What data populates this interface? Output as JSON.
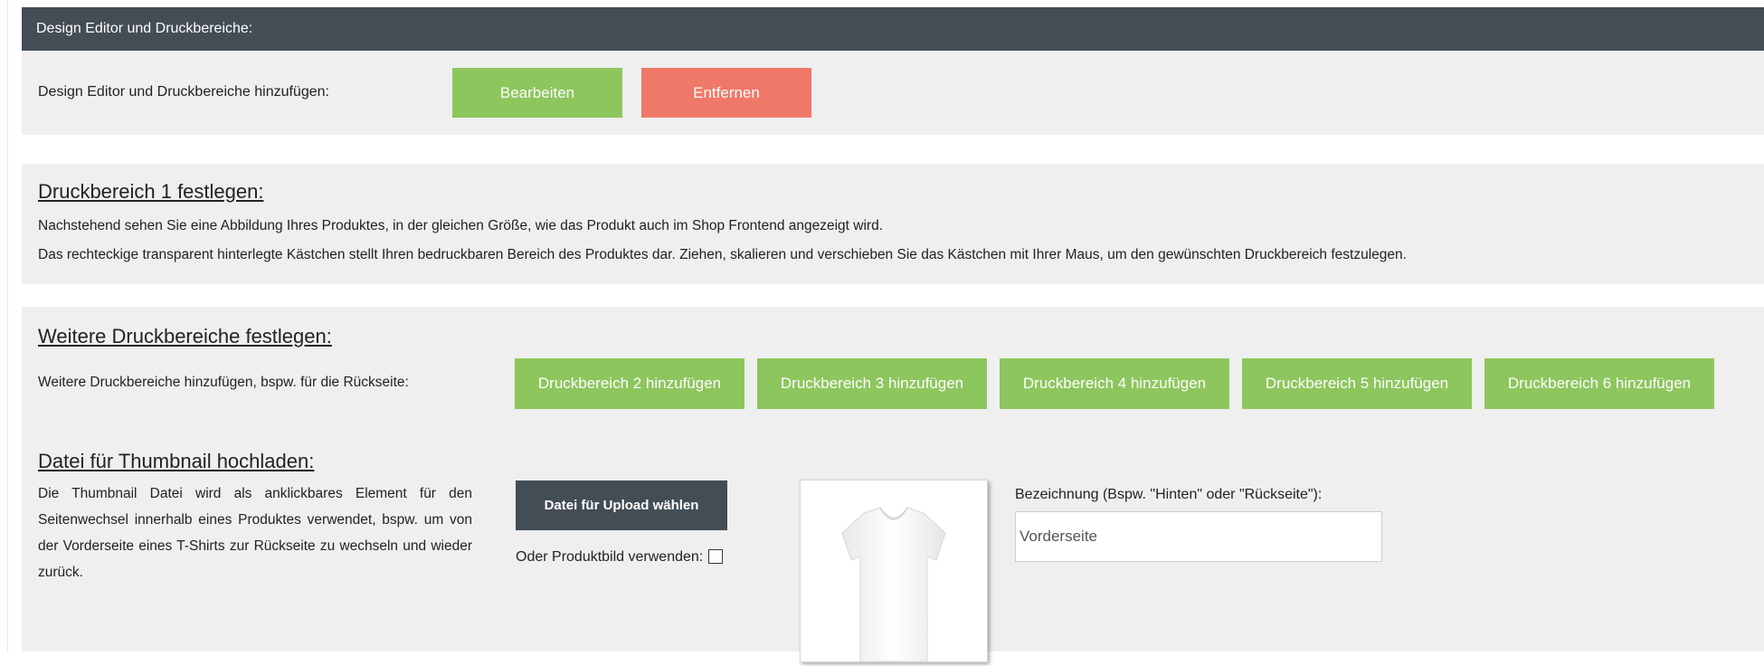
{
  "design_editor": {
    "header_title": "Design Editor und Druckbereiche:",
    "add_label": "Design Editor und Druckbereiche hinzufügen:",
    "edit_button": "Bearbeiten",
    "remove_button": "Entfernen"
  },
  "druckbereich1": {
    "title": "Druckbereich 1 festlegen:",
    "line1": "Nachstehend sehen Sie eine Abbildung Ihres Produktes, in der gleichen Größe, wie das Produkt auch im Shop Frontend angezeigt wird.",
    "line2": "Das rechteckige transparent hinterlegte Kästchen stellt Ihren bedruckbaren Bereich des Produktes dar. Ziehen, skalieren und verschieben Sie das Kästchen mit Ihrer Maus, um den gewünschten Druckbereich festzulegen."
  },
  "weitere": {
    "title": "Weitere Druckbereiche festlegen:",
    "description": "Weitere Druckbereiche hinzufügen, bspw. für die Rückseite:",
    "buttons": [
      "Druckbereich 2 hinzufügen",
      "Druckbereich 3 hinzufügen",
      "Druckbereich 4 hinzufügen",
      "Druckbereich 5 hinzufügen",
      "Druckbereich 6 hinzufügen"
    ]
  },
  "thumbnail": {
    "title": "Datei für Thumbnail hochladen:",
    "description": "Die Thumbnail Datei wird als anklickbares Element für den Seitenwechsel innerhalb eines Produktes verwendet, bspw. um von der Vorderseite eines T-Shirts zur Rückseite zu wechseln und wieder zurück.",
    "upload_button": "Datei für Upload wählen",
    "use_product_image_label": "Oder Produktbild verwenden:",
    "use_product_image_checked": false,
    "name_label": "Bezeichnung (Bspw. \"Hinten\" oder \"Rückseite\"):",
    "name_value": "Vorderseite",
    "preview_icon": "t-shirt-icon"
  },
  "colors": {
    "header": "#434d56",
    "panel": "#efefef",
    "green": "#8cc65d",
    "red": "#f07868"
  }
}
